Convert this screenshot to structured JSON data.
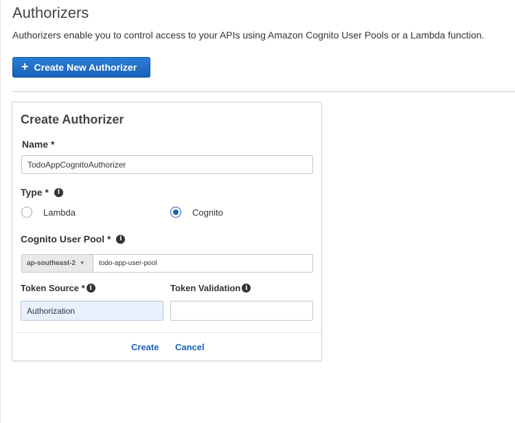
{
  "header": {
    "title": "Authorizers",
    "description": "Authorizers enable you to control access to your APIs using Amazon Cognito User Pools or a Lambda function."
  },
  "toolbar": {
    "create_button_icon": "plus-icon",
    "create_button_label": "Create New Authorizer"
  },
  "form": {
    "title": "Create Authorizer",
    "name": {
      "label": "Name *",
      "value": "TodoAppCognitoAuthorizer"
    },
    "type": {
      "label": "Type *",
      "options": [
        {
          "label": "Lambda",
          "selected": false
        },
        {
          "label": "Cognito",
          "selected": true
        }
      ]
    },
    "user_pool": {
      "label": "Cognito User Pool *",
      "region": "ap-southeast-2",
      "value": "todo-app-user-pool"
    },
    "token_source": {
      "label": "Token Source *",
      "value": "Authorization"
    },
    "token_validation": {
      "label": "Token Validation",
      "value": ""
    },
    "actions": {
      "create_label": "Create",
      "cancel_label": "Cancel"
    }
  },
  "colors": {
    "primary": "#1a62b8",
    "highlight_input": "#e7f0fd"
  }
}
